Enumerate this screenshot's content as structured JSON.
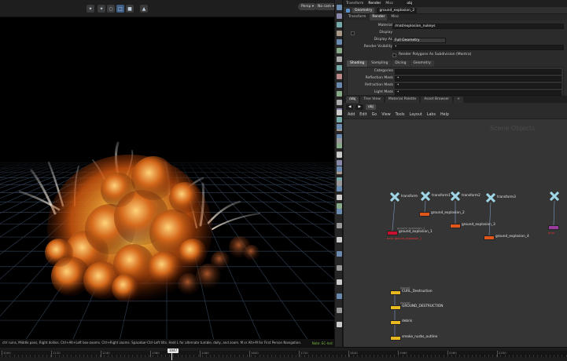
{
  "viewport": {
    "camera_menu": "Persp ▾",
    "nocam_menu": "No cam ▾",
    "status_text": "ctrl ruins, Middle pans, Right dollies. Ctrl+Alt+Left box-zooms. Ctrl+Right zooms. Spacebar-Ctrl-Left tilts. Hold L for alternate tumble, dolly, and zoom.  M or Alt+M for First Person Navigation.",
    "status_right": "Note: EC-Inst"
  },
  "params": {
    "top_tabs": [
      "Transform",
      "Render",
      "Misc"
    ],
    "path_label": "obj",
    "node_type": "Geometry",
    "node_name": "ground_explosion_2",
    "fields": {
      "material_label": "Material",
      "material_value": "/mat/explosion_nukeys",
      "display_label": "Display",
      "display_as_label": "Display As",
      "display_as_value": "Full Geometry",
      "render_visibility_label": "Render Visibility",
      "render_visibility_value": "*",
      "render_polygons_label": "Render Polygons As Subdivision (Mantra)"
    },
    "shading_tabs": [
      "Shading",
      "Sampling",
      "Dicing",
      "Geometry"
    ],
    "shading_rows": [
      {
        "label": "Categories",
        "value": ""
      },
      {
        "label": "Reflection Mask",
        "value": "*"
      },
      {
        "label": "Refraction Mask",
        "value": "*"
      },
      {
        "label": "Light Mask",
        "value": "*"
      }
    ]
  },
  "network": {
    "pane_tabs": [
      "/obj",
      "Tree View",
      "Material Palette",
      "Asset Browser",
      "+"
    ],
    "path_label": "obj",
    "menu": [
      "Add",
      "Edit",
      "Go",
      "View",
      "Tools",
      "Layout",
      "Labs",
      "Help"
    ],
    "watermark": "Scene Objects",
    "transforms": [
      {
        "label": "transform"
      },
      {
        "label": "transform1"
      },
      {
        "label": "transform2"
      },
      {
        "label": "transform3"
      },
      {
        "label": ""
      }
    ],
    "geo_nodes": [
      {
        "sub": "ground_explosion_1",
        "label": "ground_explosion_1",
        "color": "#c8102e",
        "error": "error ground_explosion_1"
      },
      {
        "sub": "",
        "label": "ground_explosion_2",
        "color": "#e0551a",
        "error": ""
      },
      {
        "sub": "",
        "label": "ground_explosion_3",
        "color": "#e0551a",
        "error": ""
      },
      {
        "sub": "",
        "label": "ground_explosion_4",
        "color": "#e0551a",
        "error": ""
      },
      {
        "sub": "",
        "label": "",
        "color": "#9a3a9c",
        "error": "error"
      }
    ],
    "sim_nodes": [
      {
        "sub": "dopnet",
        "label": "CURL_Destruction"
      },
      {
        "sub": "dopnet",
        "label": "GROUND_DESTRUCTION"
      },
      {
        "sub": "",
        "label": "debris"
      },
      {
        "sub": "",
        "label": "smoke_nurbs_outline"
      }
    ]
  },
  "timeline": {
    "current_frame": "1047",
    "ticks": [
      "1000",
      "1120",
      "1240",
      "1360",
      "1480",
      "1600",
      "1720",
      "1840",
      "1960",
      "2080",
      "2200"
    ]
  },
  "colors": {
    "accent": "#3e5e86",
    "xform_node": "#9fd6e8",
    "yellow_node": "#e7b81f",
    "error_text": "#ee3333"
  }
}
